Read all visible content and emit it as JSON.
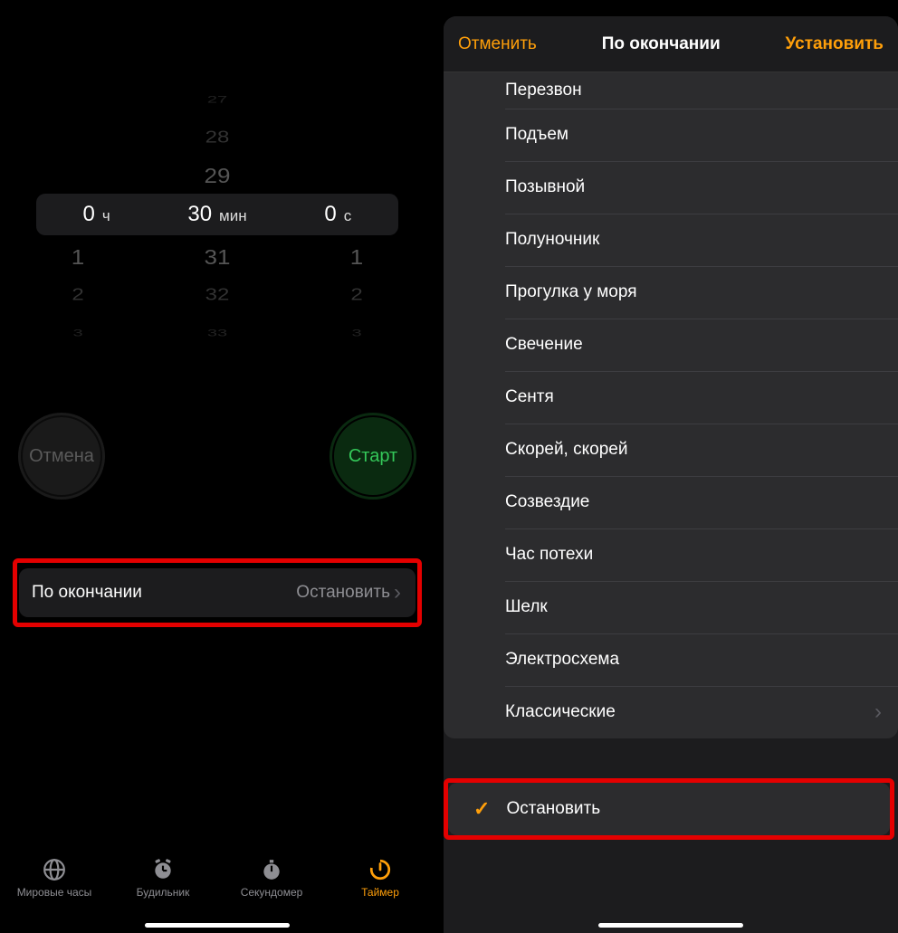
{
  "left": {
    "picker": {
      "hours": {
        "selected": "0",
        "unit": "ч",
        "above": [],
        "below": [
          "1",
          "2",
          "3"
        ]
      },
      "minutes": {
        "selected": "30",
        "unit": "мин",
        "above": [
          "27",
          "28",
          "29"
        ],
        "below": [
          "31",
          "32",
          "33"
        ]
      },
      "seconds": {
        "selected": "0",
        "unit": "с",
        "above": [],
        "below": [
          "1",
          "2",
          "3"
        ]
      }
    },
    "buttons": {
      "cancel": "Отмена",
      "start": "Старт"
    },
    "end_row": {
      "label": "По окончании",
      "value": "Остановить"
    },
    "tabs": [
      {
        "id": "world-clock",
        "label": "Мировые часы"
      },
      {
        "id": "alarm",
        "label": "Будильник"
      },
      {
        "id": "stopwatch",
        "label": "Секундомер"
      },
      {
        "id": "timer",
        "label": "Таймер",
        "active": true
      }
    ]
  },
  "right": {
    "header": {
      "cancel": "Отменить",
      "title": "По окончании",
      "set": "Установить"
    },
    "sounds": [
      "Перезвон",
      "Подъем",
      "Позывной",
      "Полуночник",
      "Прогулка у моря",
      "Свечение",
      "Сентя",
      "Скорей, скорей",
      "Созвездие",
      "Час потехи",
      "Шелк",
      "Электросхема"
    ],
    "classic": "Классические",
    "stop": "Остановить"
  }
}
